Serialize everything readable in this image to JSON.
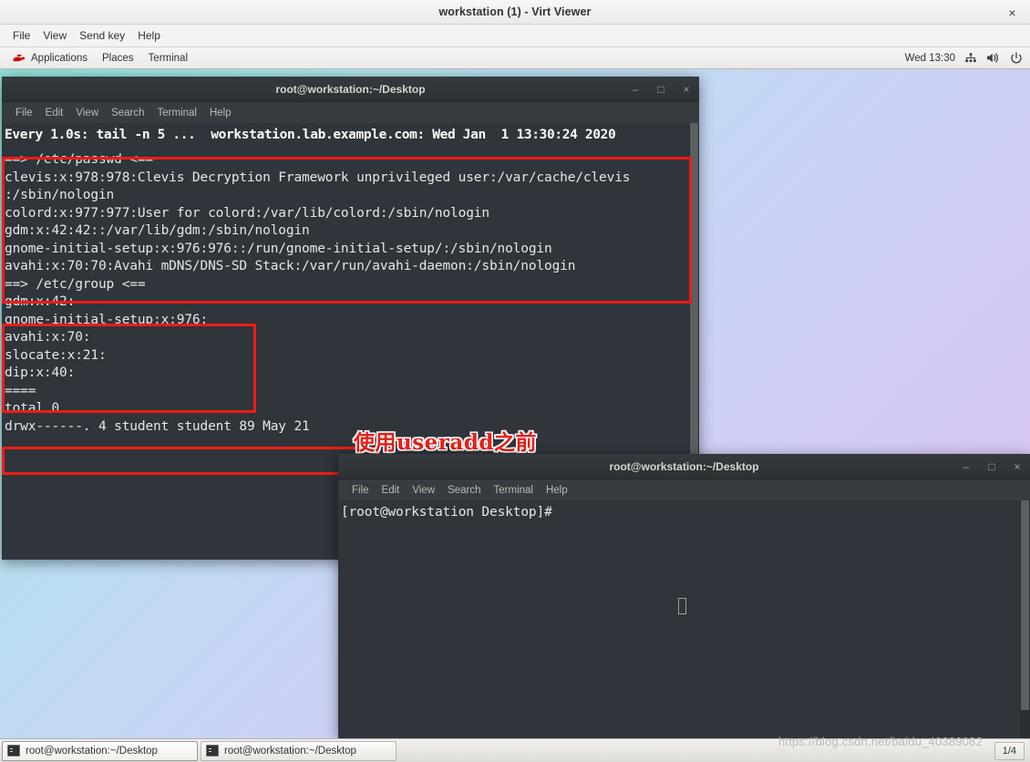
{
  "viewer": {
    "title": "workstation (1) - Virt Viewer",
    "close_label": "×",
    "menus": [
      {
        "label": "File"
      },
      {
        "label": "View"
      },
      {
        "label": "Send key"
      },
      {
        "label": "Help"
      }
    ]
  },
  "gnome_panel": {
    "applications_label": "Applications",
    "places_label": "Places",
    "terminal_label": "Terminal",
    "clock": "Wed 13:30",
    "tray": [
      {
        "name": "network-icon"
      },
      {
        "name": "volume-icon"
      },
      {
        "name": "power-icon"
      }
    ],
    "logo_color": "#cc0000"
  },
  "terminal_menus": [
    {
      "label": "File"
    },
    {
      "label": "Edit"
    },
    {
      "label": "View"
    },
    {
      "label": "Search"
    },
    {
      "label": "Terminal"
    },
    {
      "label": "Help"
    }
  ],
  "window_controls": {
    "minimize": "–",
    "maximize": "□",
    "close": "×"
  },
  "terminal_one": {
    "title": "root@workstation:~/Desktop",
    "watch_header": "Every 1.0s: tail -n 5 ...  workstation.lab.example.com: Wed Jan  1 13:30:24 2020",
    "lines": [
      "==> /etc/passwd <==",
      "clevis:x:978:978:Clevis Decryption Framework unprivileged user:/var/cache/clevis",
      ":/sbin/nologin",
      "colord:x:977:977:User for colord:/var/lib/colord:/sbin/nologin",
      "gdm:x:42:42::/var/lib/gdm:/sbin/nologin",
      "gnome-initial-setup:x:976:976::/run/gnome-initial-setup/:/sbin/nologin",
      "avahi:x:70:70:Avahi mDNS/DNS-SD Stack:/var/run/avahi-daemon:/sbin/nologin",
      "",
      "==> /etc/group <==",
      "gdm:x:42:",
      "gnome-initial-setup:x:976:",
      "avahi:x:70:",
      "slocate:x:21:",
      "dip:x:40:",
      "====",
      "total 0",
      "drwx------. 4 student student 89 May 21"
    ]
  },
  "terminal_two": {
    "title": "root@workstation:~/Desktop",
    "prompt": "[root@workstation Desktop]#"
  },
  "annotation": {
    "text": "使用useradd之前",
    "color": "#e8201a",
    "box_color": "#ee1c15"
  },
  "taskbar": {
    "buttons": [
      {
        "label": "root@workstation:~/Desktop"
      },
      {
        "label": "root@workstation:~/Desktop"
      }
    ],
    "workspace": "1/4"
  },
  "watermark": {
    "text": "https://blog.csdn.net/baidu_40389082"
  }
}
